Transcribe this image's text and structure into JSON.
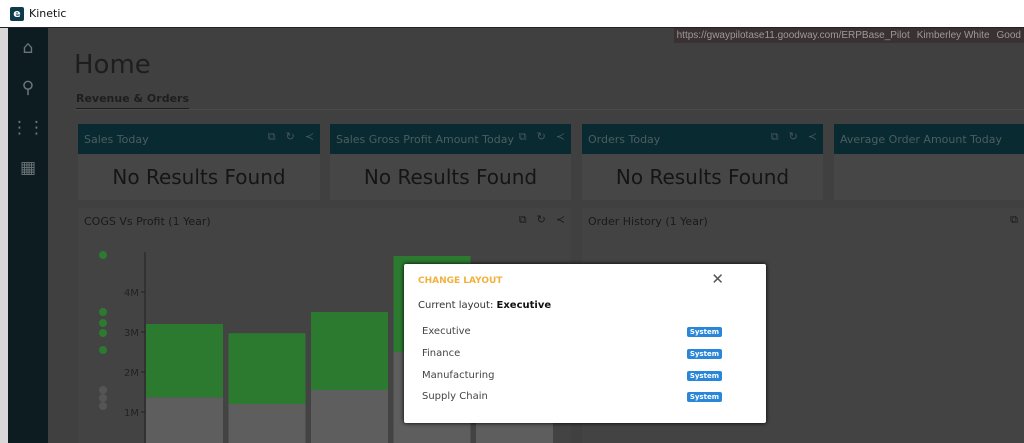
{
  "window": {
    "title": "Kinetic"
  },
  "header": {
    "url": "https://gwaypilotase11.goodway.com/ERPBase_Pilot",
    "user": "Kimberley White",
    "company": "Good"
  },
  "sidebar": {
    "items": [
      {
        "icon": "home-icon",
        "glyph": "⌂"
      },
      {
        "icon": "search-icon",
        "glyph": "⚲"
      },
      {
        "icon": "apps-grid-icon",
        "glyph": "⋮⋮"
      },
      {
        "icon": "dashboard-icon",
        "glyph": "▦"
      }
    ]
  },
  "page": {
    "title": "Home",
    "tab": "Revenue & Orders"
  },
  "cards": [
    {
      "title": "Sales Today",
      "body": "No Results Found"
    },
    {
      "title": "Sales Gross Profit Amount Today",
      "body": "No Results Found"
    },
    {
      "title": "Orders Today",
      "body": "No Results Found"
    },
    {
      "title": "Average Order Amount Today",
      "body": ""
    }
  ],
  "charts": [
    {
      "title": "COGS Vs Profit (1 Year)"
    },
    {
      "title": "Order History (1 Year)"
    }
  ],
  "chart_data": {
    "type": "bar",
    "stacked": true,
    "yticks": [
      "1M",
      "2M",
      "3M",
      "4M"
    ],
    "ylim": [
      0,
      5
    ],
    "series": [
      {
        "values": [
          1.37,
          1.2,
          1.55,
          2.5,
          0.8
        ],
        "color": "#5e5e5e"
      },
      {
        "values": [
          1.83,
          1.77,
          1.95,
          2.4,
          null
        ],
        "color": "#2c7a30"
      }
    ]
  },
  "dialog": {
    "title": "CHANGE LAYOUT",
    "current_label": "Current layout:",
    "current_value": "Executive",
    "options": [
      {
        "name": "Executive",
        "badge": "System"
      },
      {
        "name": "Finance",
        "badge": "System"
      },
      {
        "name": "Manufacturing",
        "badge": "System"
      },
      {
        "name": "Supply Chain",
        "badge": "System"
      }
    ],
    "accent": "#f1b13c",
    "badge_color": "#2a86d8"
  }
}
